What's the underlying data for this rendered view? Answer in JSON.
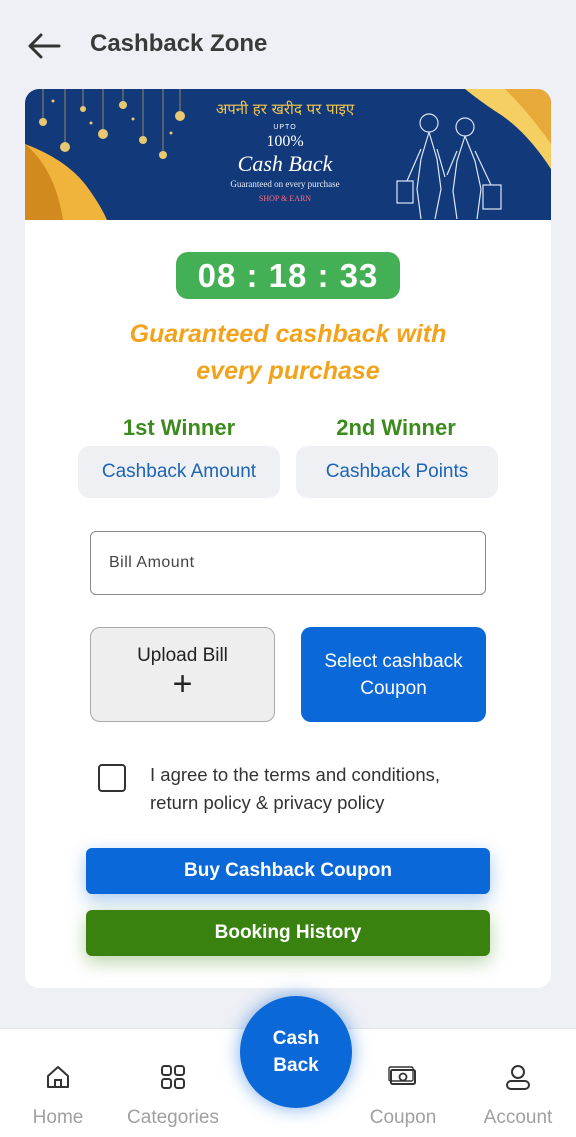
{
  "header": {
    "title": "Cashback Zone"
  },
  "banner": {
    "hindi_text": "अपनी हर खरीद पर पाइए",
    "upto": "UPTO",
    "percent": "100%",
    "cash_back": "Cash Back",
    "guarantee": "Guaranteed on every purchase",
    "shop_earn": "SHOP & EARN"
  },
  "timer": {
    "value": "08 : 18 : 33"
  },
  "promo": {
    "line1": "Guaranteed cashback with",
    "line2": "every purchase"
  },
  "winners": {
    "first_label": "1st Winner",
    "first_button": "Cashback Amount",
    "second_label": "2nd Winner",
    "second_button": "Cashback Points"
  },
  "form": {
    "bill_placeholder": "Bill Amount",
    "upload_label": "Upload Bill",
    "upload_plus": "+",
    "select_coupon": "Select cashback Coupon",
    "terms_line1": "I agree to the terms and conditions,",
    "terms_line2": "return policy & privacy policy",
    "buy_button": "Buy Cashback Coupon",
    "history_button": "Booking History"
  },
  "colors": {
    "primary_blue": "#0b68d8",
    "green": "#3a820f",
    "timer_green": "#44b055",
    "promo_orange": "#f2a31b",
    "banner_blue": "#123a7a"
  },
  "bottom_nav": {
    "items": [
      {
        "label": "Home",
        "icon": "home-icon"
      },
      {
        "label": "Categories",
        "icon": "grid-icon"
      },
      {
        "label": "Coupon",
        "icon": "cash-icon"
      },
      {
        "label": "Account",
        "icon": "user-icon"
      }
    ],
    "fab_line1": "Cash",
    "fab_line2": "Back"
  }
}
